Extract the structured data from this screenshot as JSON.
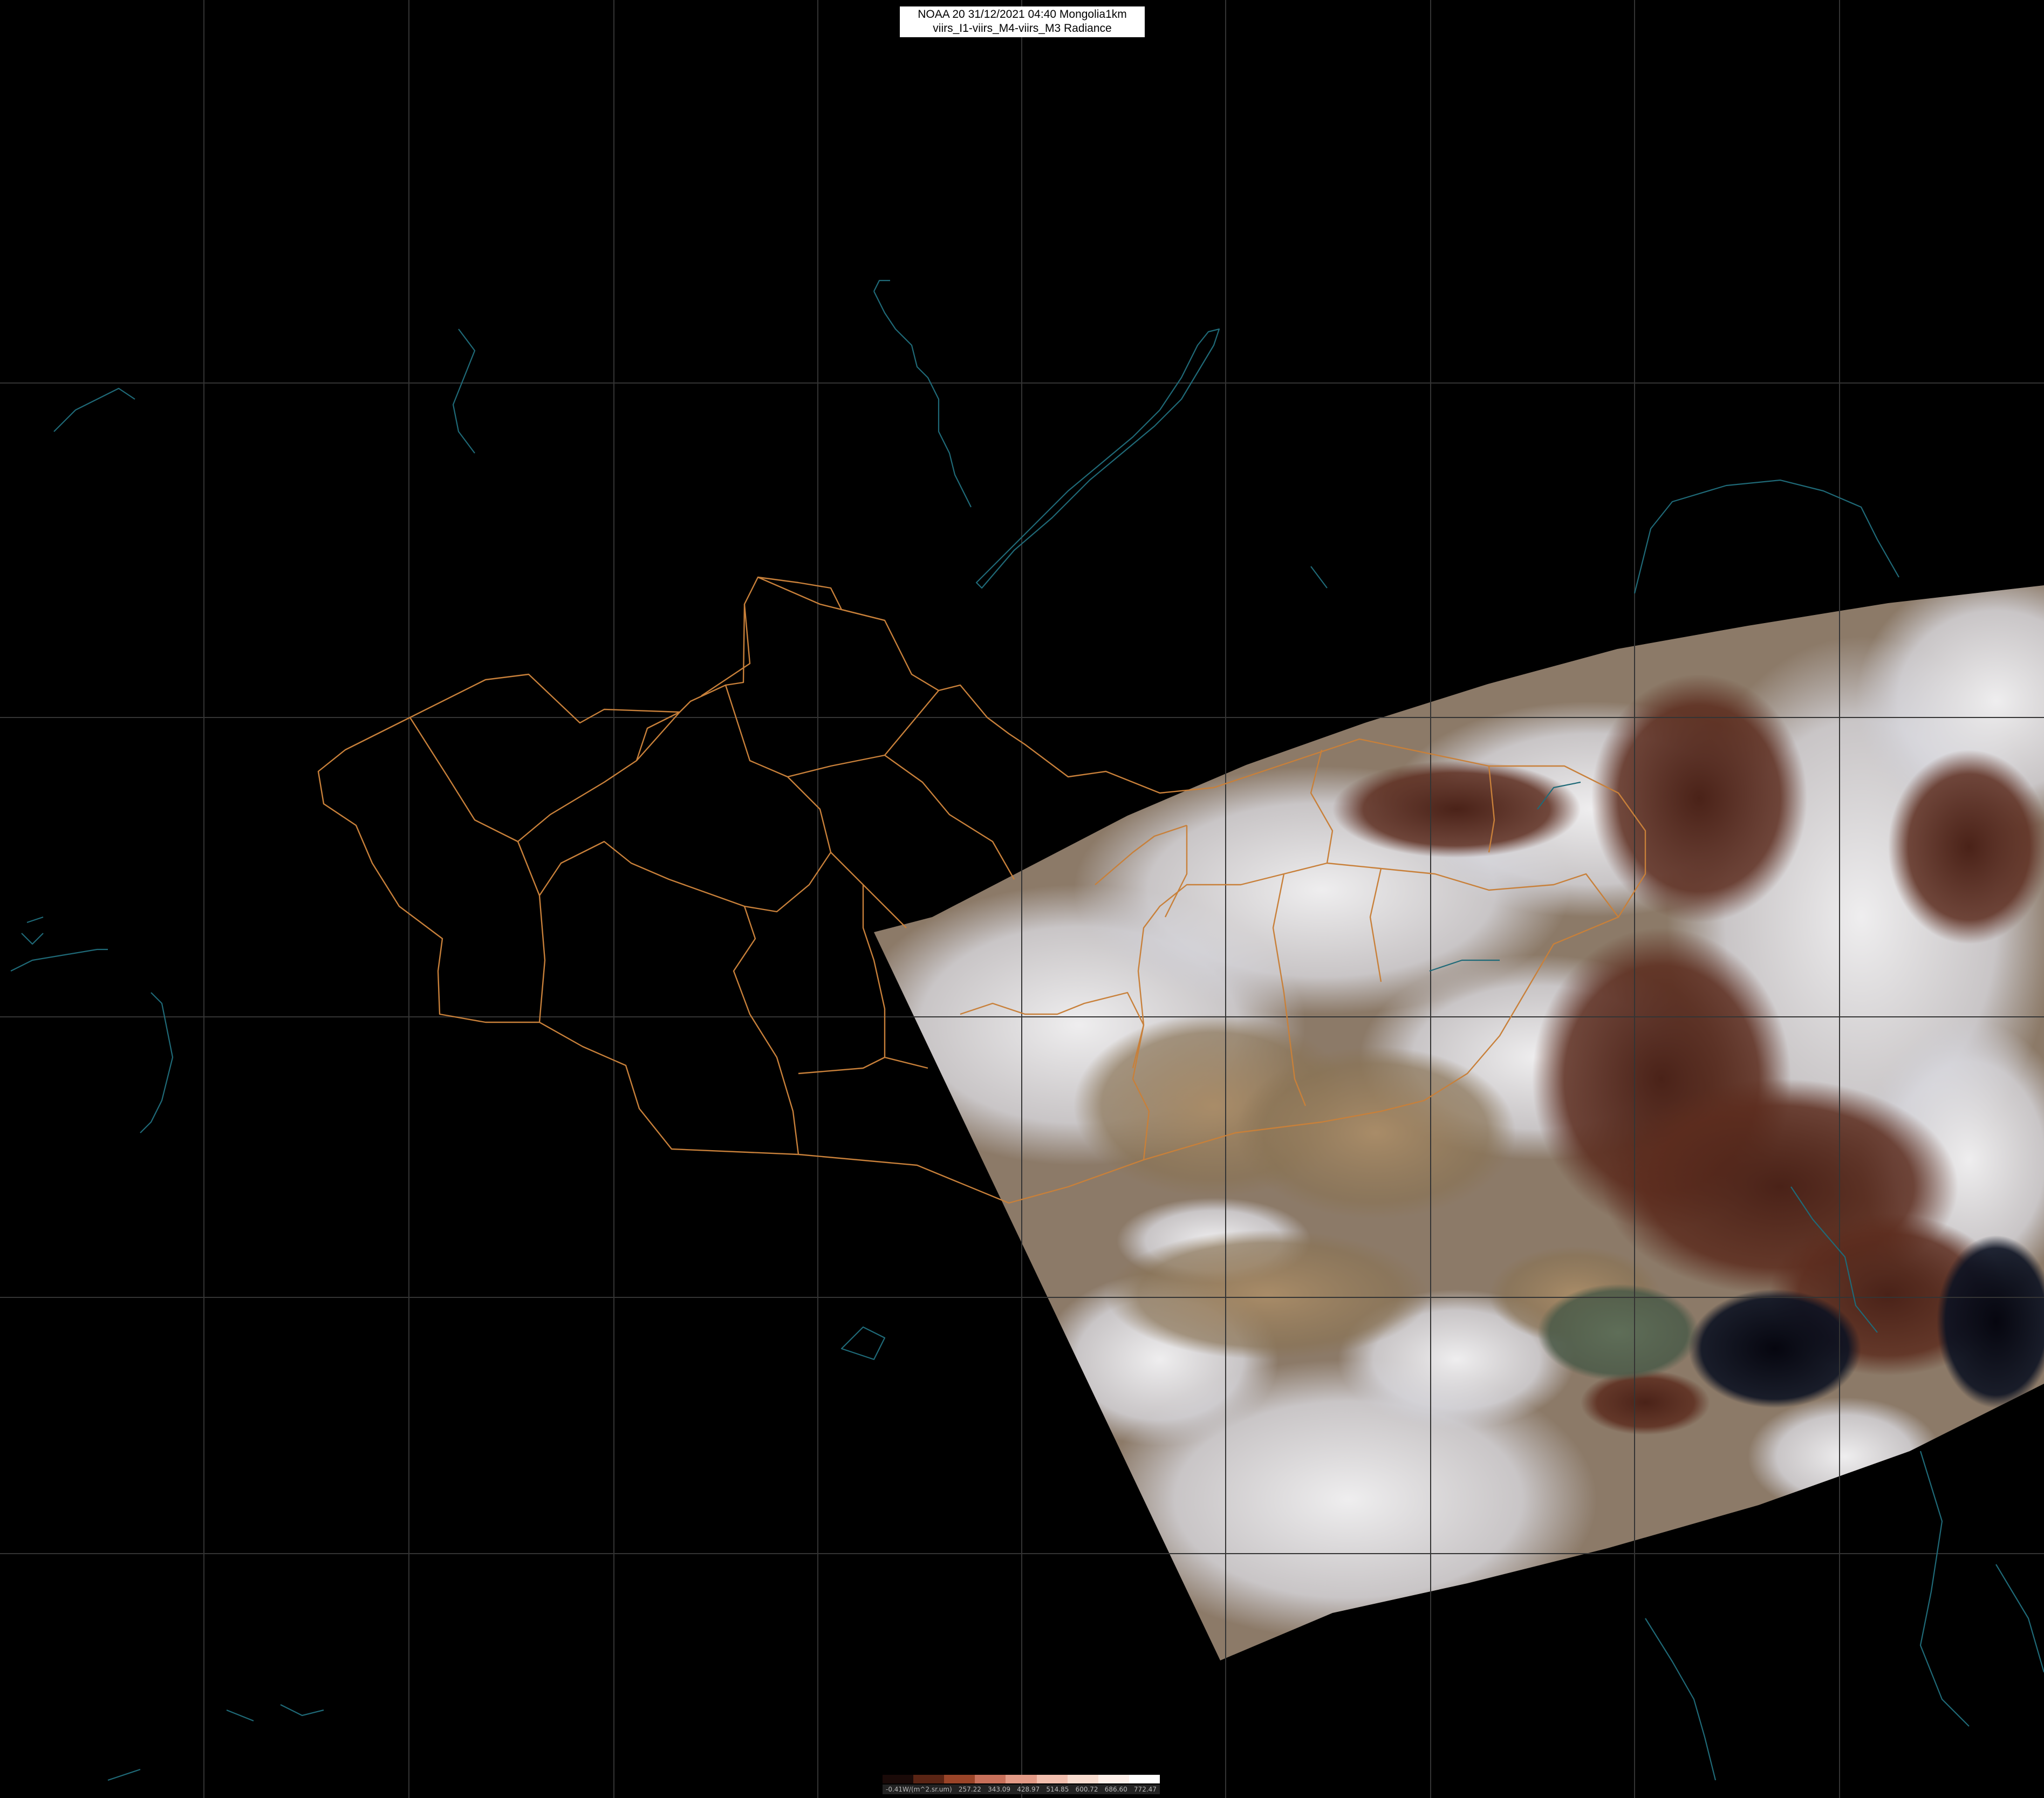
{
  "title": {
    "line1": "NOAA 20 31/12/2021 04:40 Mongolia1km",
    "line2": "viirs_I1-viirs_M4-viirs_M3 Radiance"
  },
  "colorbar": {
    "labels": [
      "-0.41W/(m^2.sr.um)",
      "257.22",
      "343.09",
      "428.97",
      "514.85",
      "600.72",
      "686.60",
      "772.47"
    ],
    "colors": [
      "#1a0a08",
      "#5a2414",
      "#9a4428",
      "#c8705a",
      "#e39a86",
      "#f2bfae",
      "#f8dccf",
      "#fdf0ea",
      "#ffffff"
    ]
  },
  "map": {
    "background_color": "#000000",
    "grid_color": "#333333",
    "border_color": "#c8803a",
    "coast_color": "#1f6a78",
    "snow_color": "#e8e8ec",
    "terrain_color": "#5a2e20",
    "desert_color": "#a48866",
    "sea_color": "#0a0a16"
  }
}
